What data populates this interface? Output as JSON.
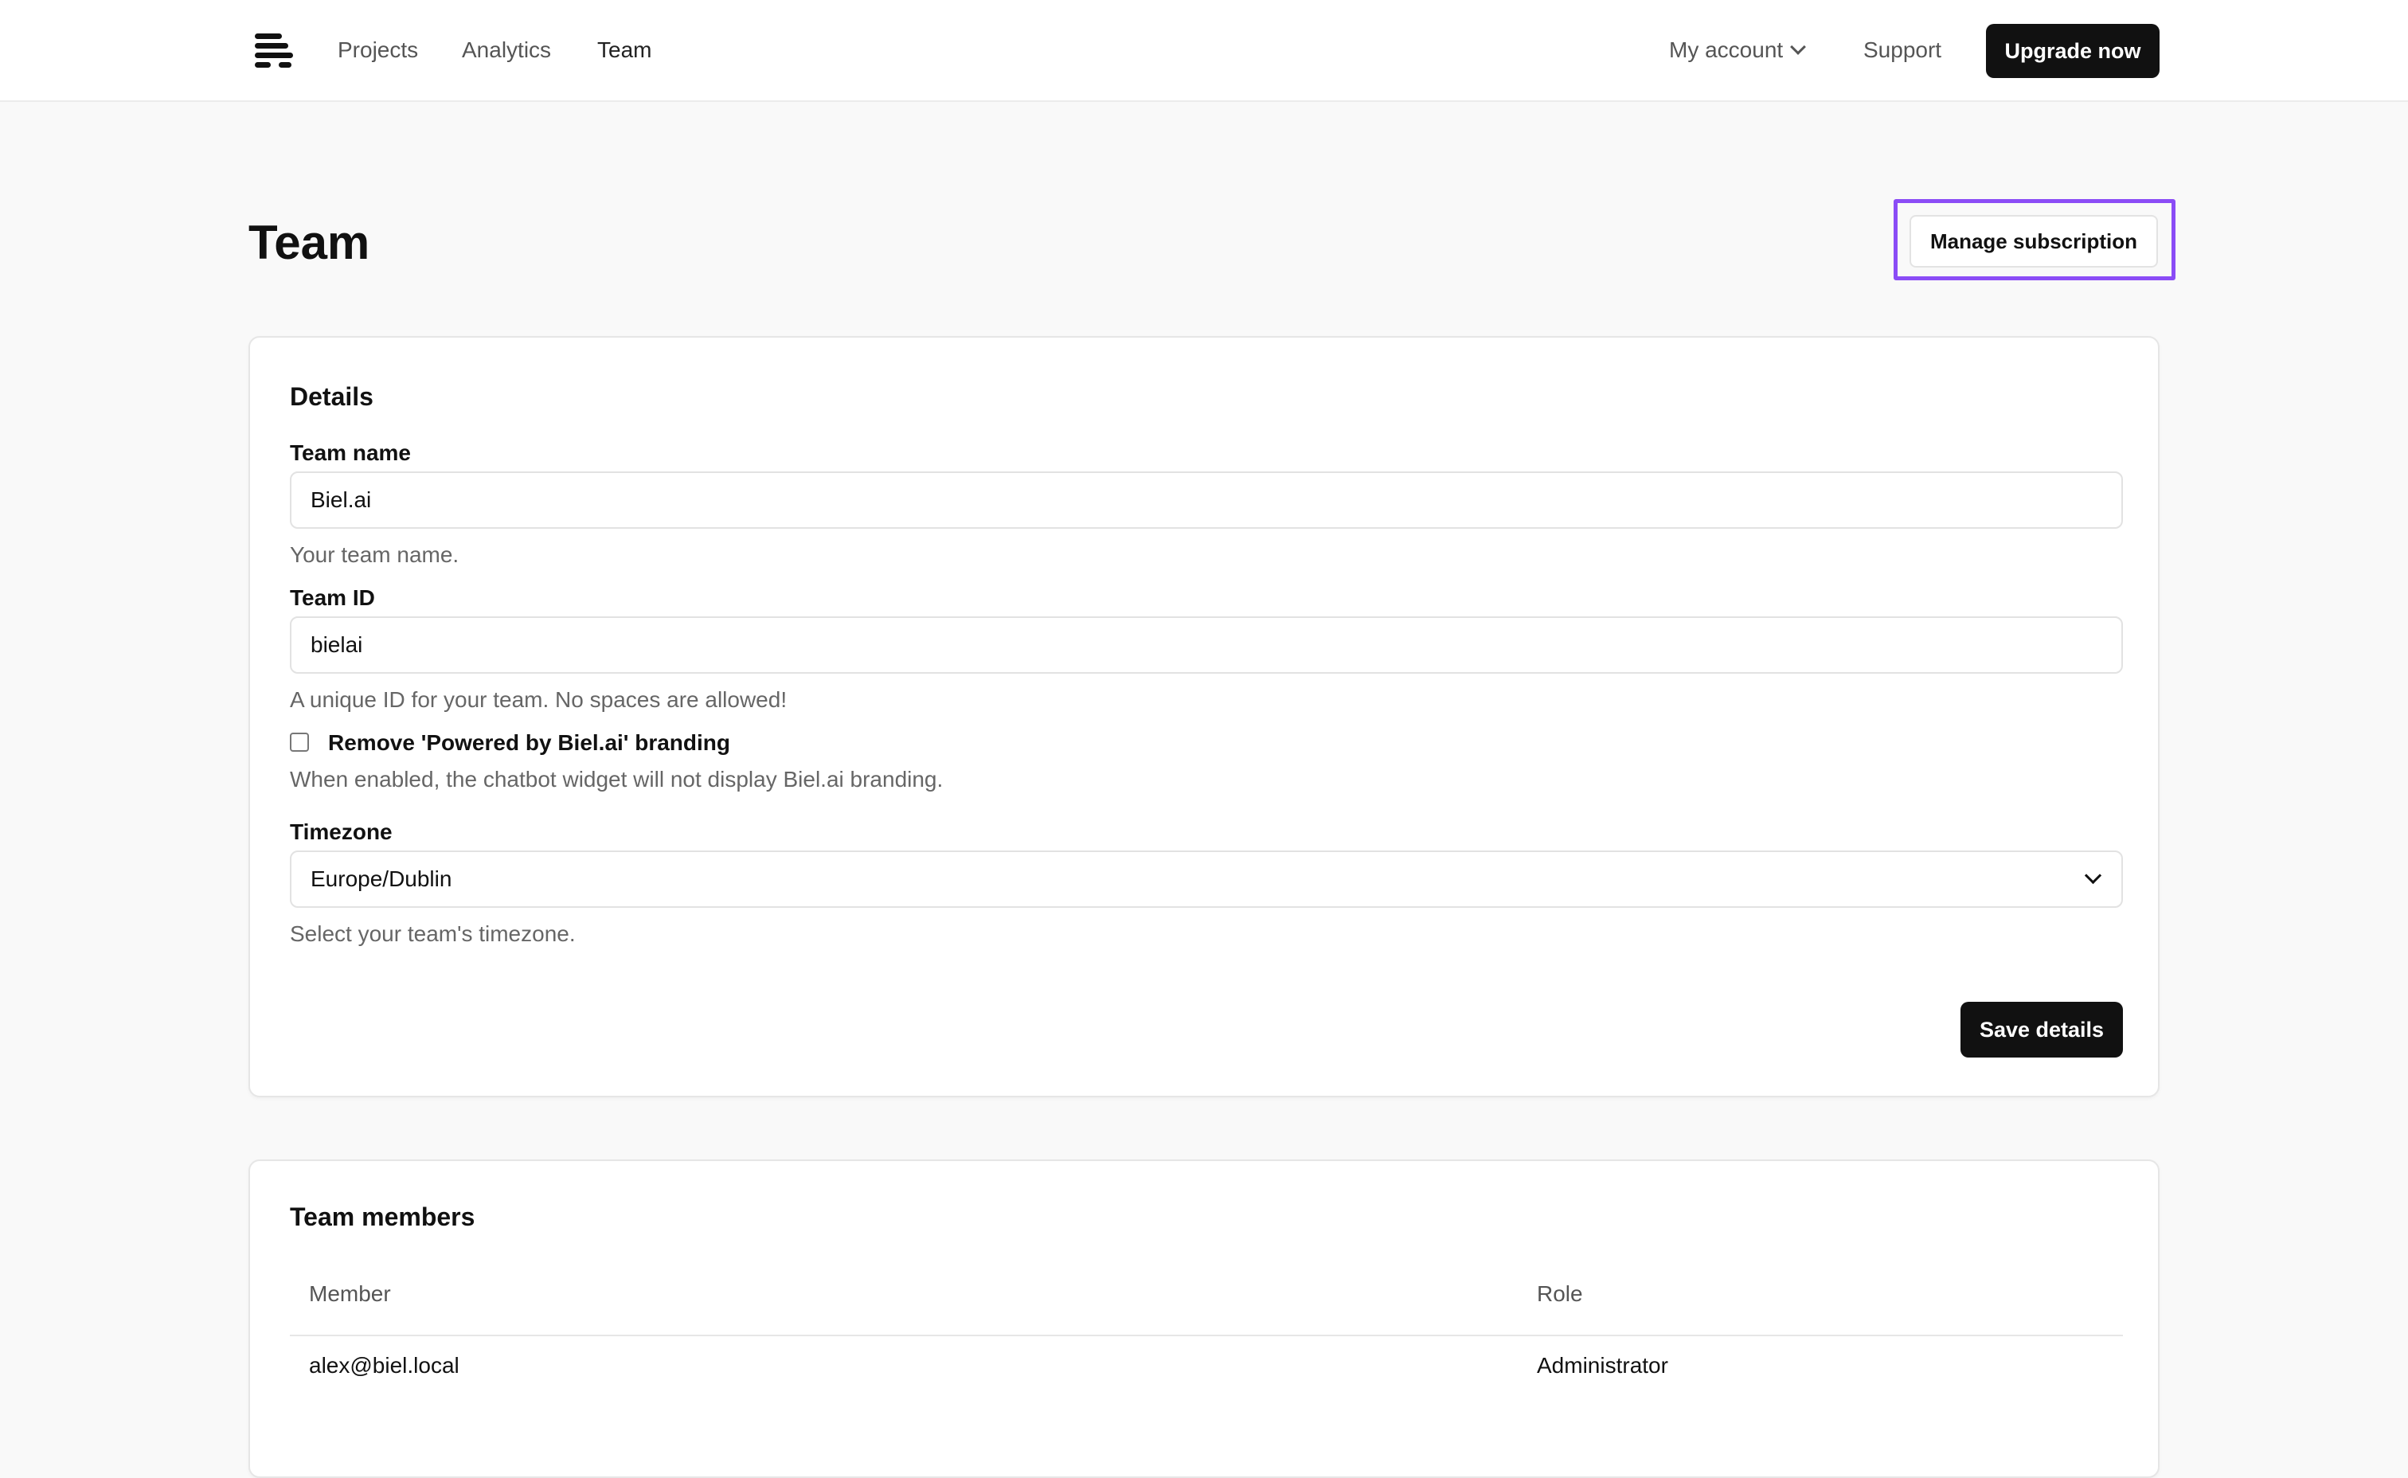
{
  "nav": {
    "links": [
      "Projects",
      "Analytics",
      "Team"
    ],
    "my_account": "My account",
    "support": "Support",
    "upgrade": "Upgrade now"
  },
  "page": {
    "title": "Team",
    "manage_subscription": "Manage subscription"
  },
  "details": {
    "heading": "Details",
    "team_name": {
      "label": "Team name",
      "value": "Biel.ai",
      "help": "Your team name."
    },
    "team_id": {
      "label": "Team ID",
      "value": "bielai",
      "help": "A unique ID for your team. No spaces are allowed!"
    },
    "branding": {
      "label": "Remove 'Powered by Biel.ai' branding",
      "checked": false,
      "help": "When enabled, the chatbot widget will not display Biel.ai branding."
    },
    "timezone": {
      "label": "Timezone",
      "value": "Europe/Dublin",
      "help": "Select your team's timezone."
    },
    "save": "Save details"
  },
  "members": {
    "heading": "Team members",
    "columns": [
      "Member",
      "Role"
    ],
    "rows": [
      {
        "member": "alex@biel.local",
        "role": "Administrator"
      }
    ]
  },
  "colors": {
    "accent_outline": "#8b4cf6",
    "primary_button": "#111111",
    "background": "#f9f9f9"
  }
}
